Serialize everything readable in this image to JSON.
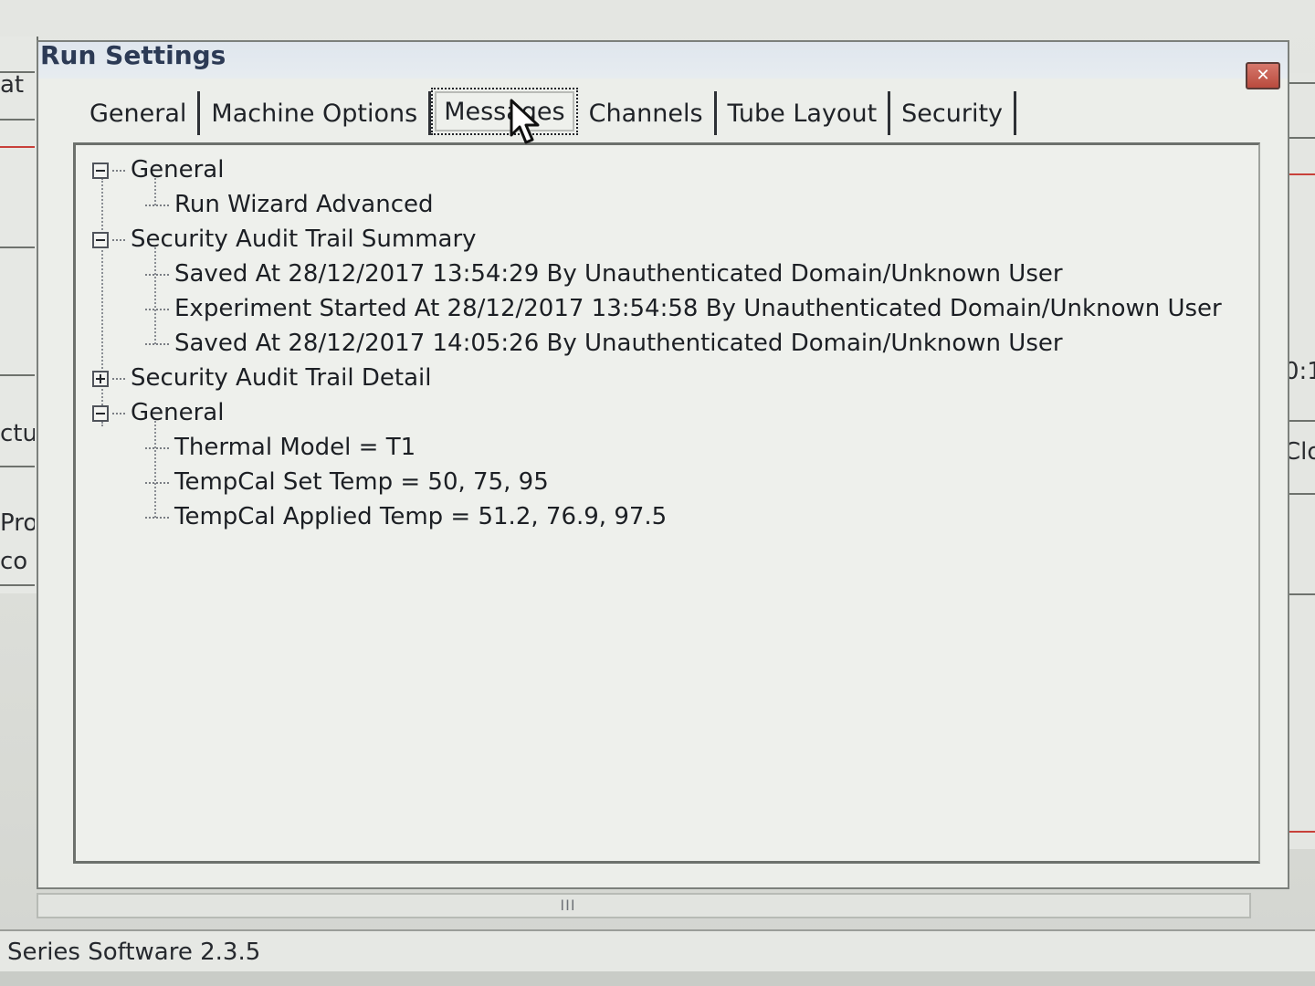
{
  "dialog": {
    "title": "Run Settings",
    "close_label": "✕"
  },
  "tabs": [
    {
      "label": "General"
    },
    {
      "label": "Machine Options"
    },
    {
      "label": "Messages",
      "active": true
    },
    {
      "label": "Channels"
    },
    {
      "label": "Tube Layout"
    },
    {
      "label": "Security"
    }
  ],
  "tree": {
    "general1": {
      "label": "General",
      "children": [
        "Run Wizard Advanced"
      ]
    },
    "summary": {
      "label": "Security Audit Trail Summary",
      "children": [
        "Saved At 28/12/2017 13:54:29 By Unauthenticated Domain/Unknown User",
        "Experiment Started At 28/12/2017 13:54:58 By Unauthenticated Domain/Unknown User",
        "Saved At 28/12/2017 14:05:26 By Unauthenticated Domain/Unknown User"
      ]
    },
    "detail": {
      "label": "Security Audit Trail Detail"
    },
    "general2": {
      "label": "General",
      "children": [
        "Thermal Model =  T1",
        "TempCal Set Temp = 50, 75, 95",
        "TempCal Applied Temp = 51.2, 76.9, 97.5"
      ]
    }
  },
  "scrollbar": {
    "grip": "III"
  },
  "status": {
    "text": "Series Software 2.3.5"
  },
  "background": {
    "left_fragments": [
      "at",
      "ctu",
      "Pro",
      "co"
    ],
    "right_fragments": [
      "0:1",
      "Clo"
    ]
  }
}
